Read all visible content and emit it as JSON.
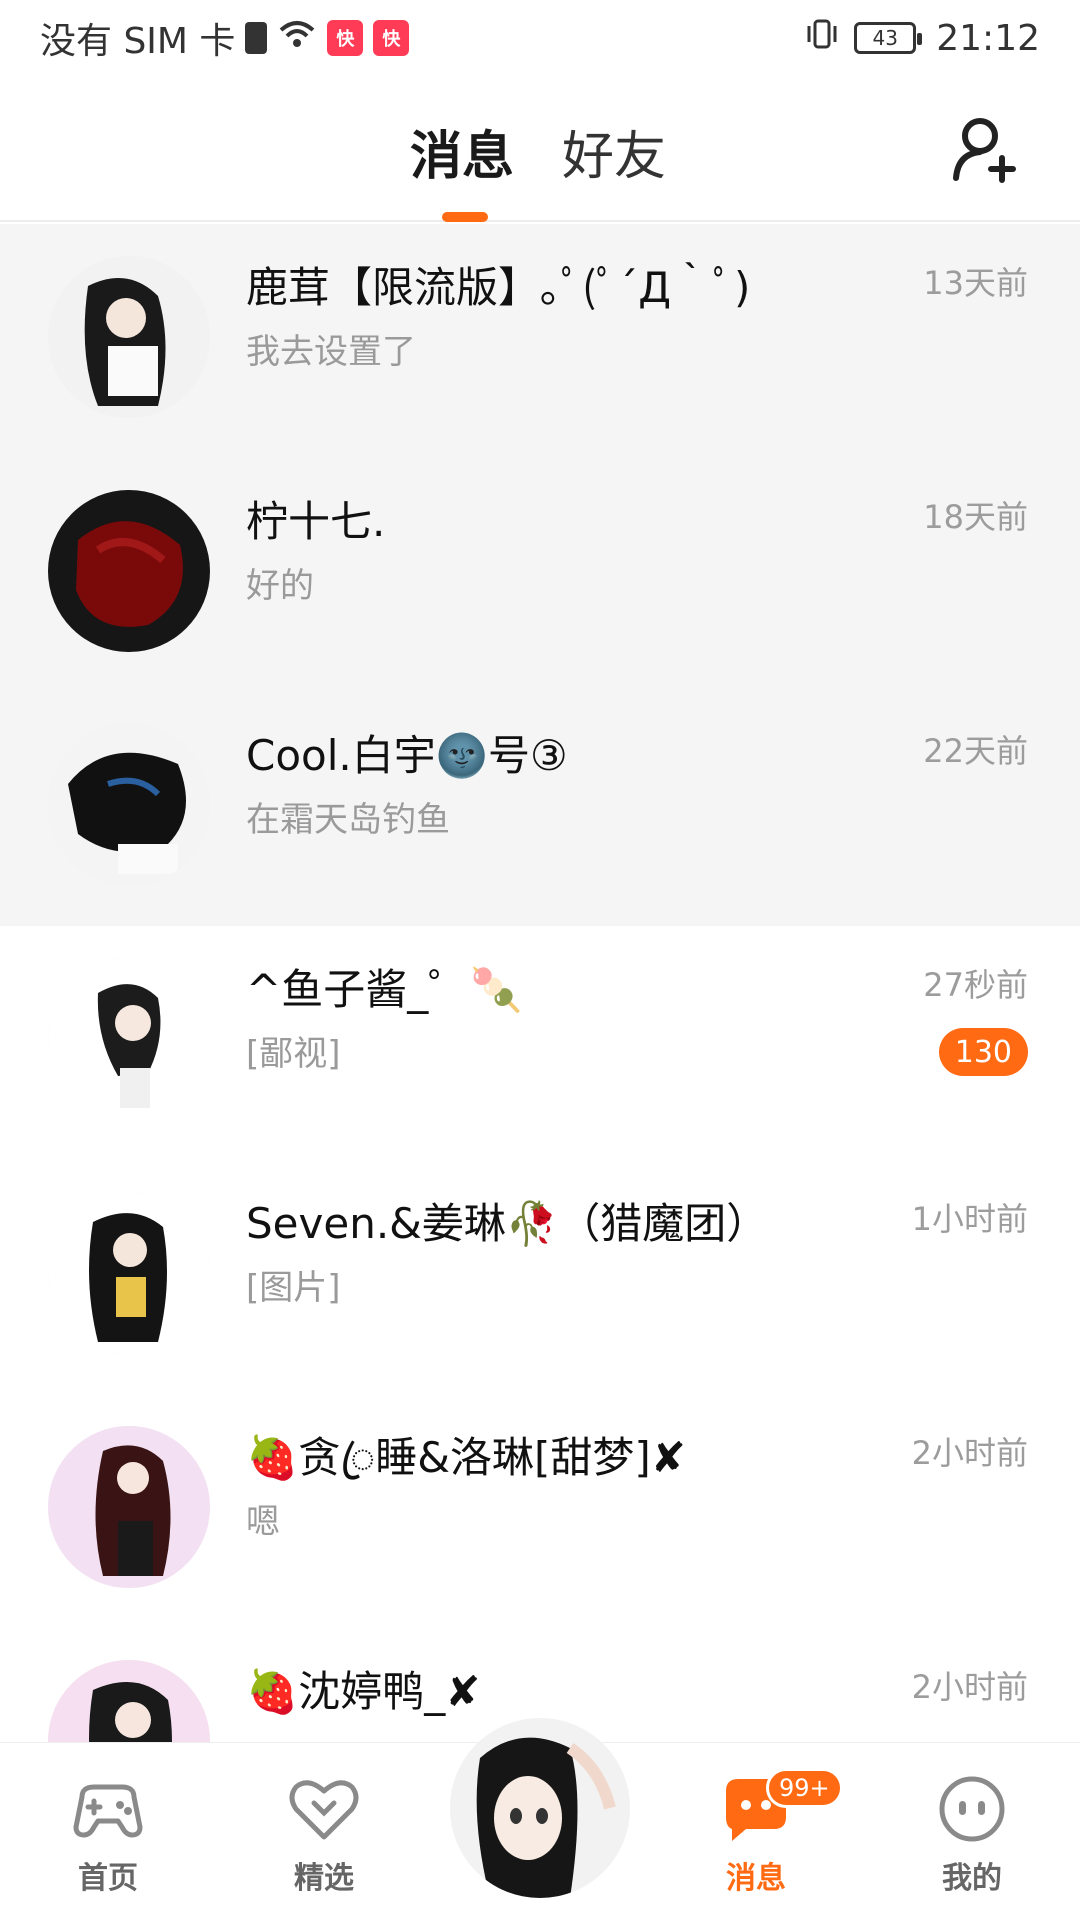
{
  "status_bar": {
    "carrier": "没有 SIM 卡",
    "battery": "43",
    "time": "21:12"
  },
  "header": {
    "tabs": [
      {
        "label": "消息"
      },
      {
        "label": "好友"
      }
    ],
    "add_friend_icon": "add-friend-icon"
  },
  "conversations": [
    {
      "name": "鹿茸【限流版】｡ﾟ(ﾟ´Д｀ﾟ)",
      "preview": "我去设置了",
      "time": "13天前",
      "pinned": true
    },
    {
      "name": "柠十七.",
      "preview": "好的",
      "time": "18天前",
      "pinned": true
    },
    {
      "name": "Cool.白宇🌚号③",
      "preview": "在霜天岛钓鱼",
      "time": "22天前",
      "pinned": true
    },
    {
      "name": "^鱼子酱_゜🍡",
      "preview": "[鄙视]",
      "time": "27秒前",
      "unread": "130"
    },
    {
      "name": "Seven.&姜琳🥀（猎魔团）",
      "preview": "[图片]",
      "time": "1小时前"
    },
    {
      "name": "🍓贪ꦿ睡&洛琳[甜梦]✘",
      "preview": "嗯",
      "time": "2小时前"
    },
    {
      "name": "🍓沈婷鸭_✘",
      "preview": "",
      "time": "2小时前"
    }
  ],
  "bottom_nav": {
    "items": [
      {
        "label": "首页",
        "icon": "gamepad-icon"
      },
      {
        "label": "精选",
        "icon": "heart-icon"
      },
      {
        "label": "消息",
        "icon": "chat-icon"
      },
      {
        "label": "我的",
        "icon": "face-icon"
      }
    ],
    "message_badge": "99+"
  },
  "colors": {
    "accent": "#ff6a13",
    "pinned_bg": "#f5f5f5"
  }
}
